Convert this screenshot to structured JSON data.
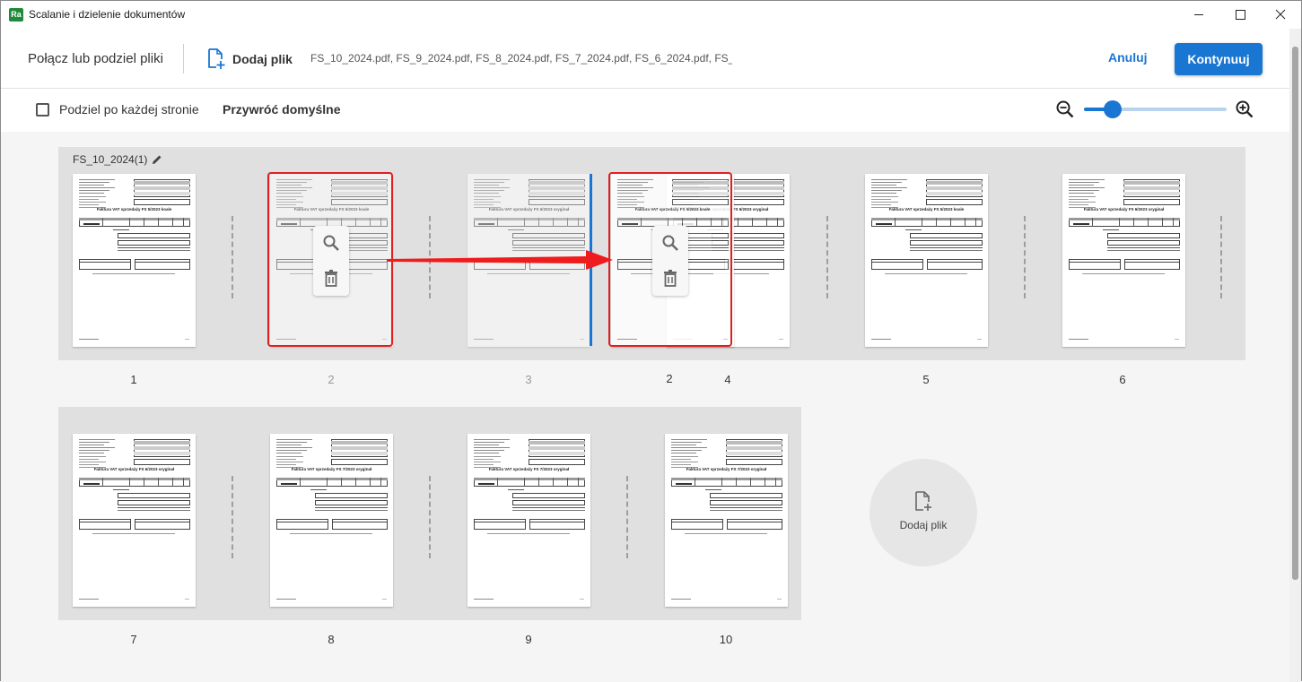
{
  "window": {
    "title": "Scalanie i dzielenie dokumentów",
    "app_icon_text": "Ra"
  },
  "toolbar": {
    "title": "Połącz lub podziel pliki",
    "add_file_label": "Dodaj plik",
    "file_list": "FS_10_2024.pdf, FS_9_2024.pdf, FS_8_2024.pdf, FS_7_2024.pdf, FS_6_2024.pdf, FS_...",
    "cancel_label": "Anuluj",
    "continue_label": "Kontynuuj"
  },
  "options": {
    "split_each_page_label": "Podziel po każdej stronie",
    "split_each_page_checked": false,
    "restore_defaults_label": "Przywróć domyślne",
    "zoom_level": 0.2
  },
  "groups": [
    {
      "label": "FS_10_2024(1)",
      "pages": [
        "1",
        "2",
        "3",
        "4",
        "5",
        "6"
      ],
      "dragged_page_label": "2"
    },
    {
      "label": "",
      "pages": [
        "7",
        "8",
        "9",
        "10"
      ]
    }
  ],
  "invoice_titles": [
    "Faktura VAT sprzedaży FS 5/2023 koale",
    "Faktura VAT sprzedaży FS 6/2023 oryginał",
    "Faktura VAT sprzedaży FS 7/2023 oryginał"
  ],
  "add_file_card_label": "Dodaj plik",
  "colors": {
    "accent": "#1976d2",
    "selection": "#e02020",
    "group_bg": "#e0e0e0",
    "canvas_bg": "#f5f5f5"
  }
}
